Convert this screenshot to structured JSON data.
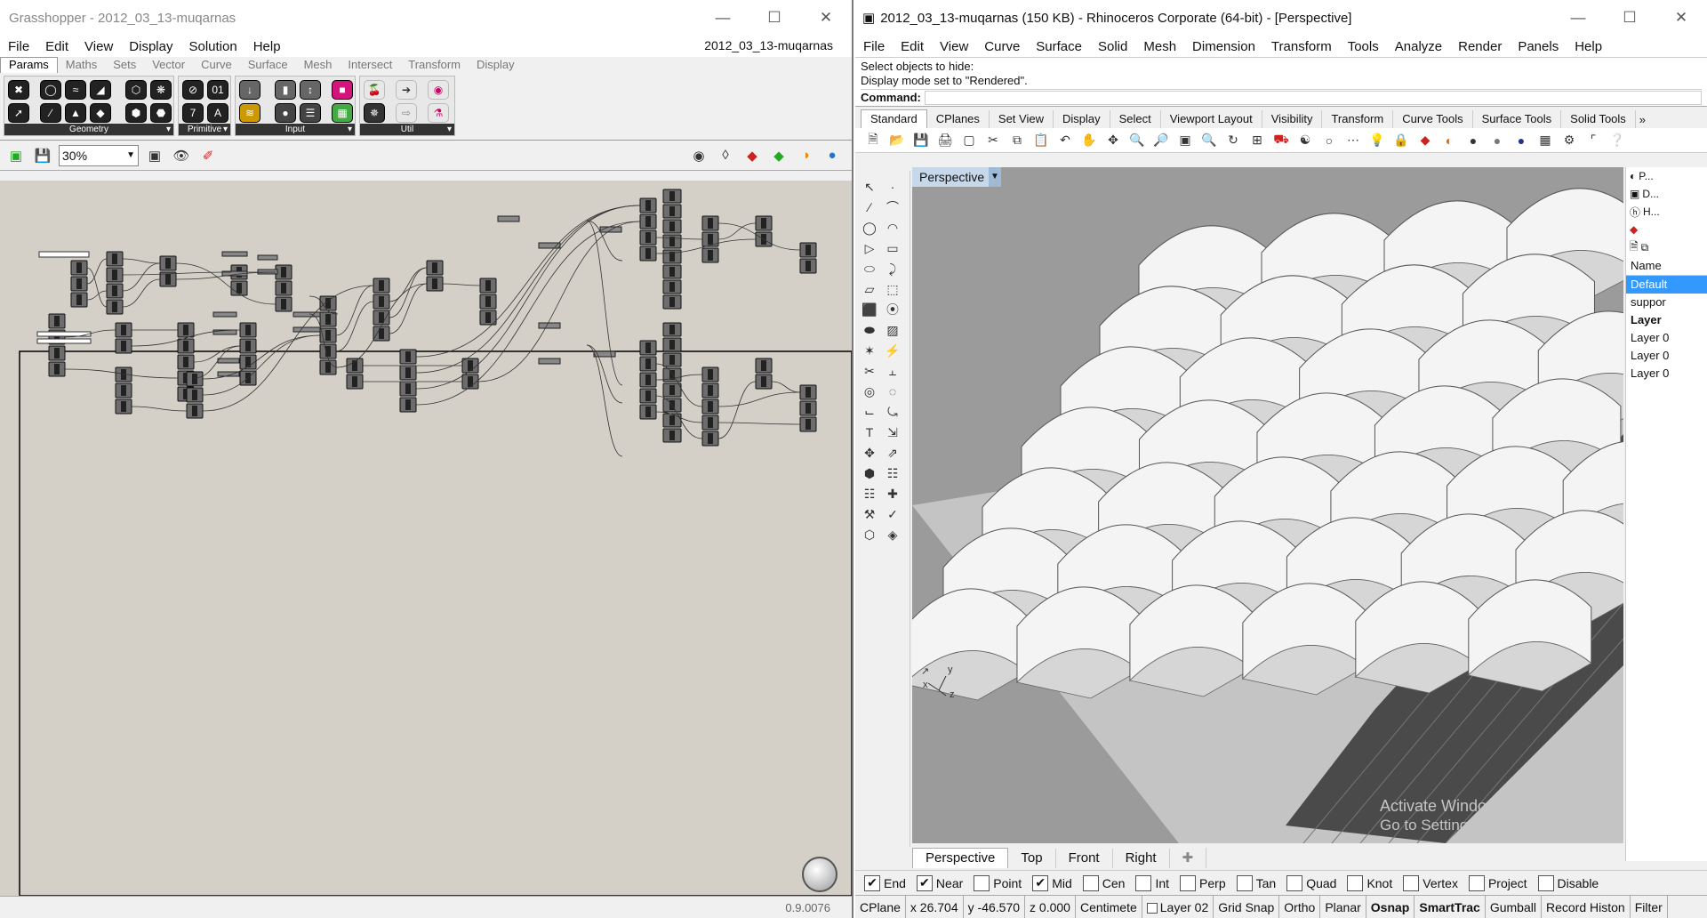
{
  "grasshopper": {
    "title": "Grasshopper - 2012_03_13-muqarnas",
    "document_name": "2012_03_13-muqarnas",
    "menu": [
      "File",
      "Edit",
      "View",
      "Display",
      "Solution",
      "Help"
    ],
    "tabs": [
      {
        "label": "Params",
        "active": true
      },
      {
        "label": "Maths",
        "active": false
      },
      {
        "label": "Sets",
        "active": false
      },
      {
        "label": "Vector",
        "active": false
      },
      {
        "label": "Curve",
        "active": false
      },
      {
        "label": "Surface",
        "active": false
      },
      {
        "label": "Mesh",
        "active": false
      },
      {
        "label": "Intersect",
        "active": false
      },
      {
        "label": "Transform",
        "active": false
      },
      {
        "label": "Display",
        "active": false
      }
    ],
    "panels": [
      "Geometry",
      "Primitive",
      "Input",
      "Util"
    ],
    "zoom": "30%",
    "version": "0.9.0076"
  },
  "rhino": {
    "title": "2012_03_13-muqarnas (150 KB) - Rhinoceros Corporate (64-bit) - [Perspective]",
    "menu": [
      "File",
      "Edit",
      "View",
      "Curve",
      "Surface",
      "Solid",
      "Mesh",
      "Dimension",
      "Transform",
      "Tools",
      "Analyze",
      "Render",
      "Panels",
      "Help"
    ],
    "command_history": [
      "Select objects to hide:",
      "Display mode set to \"Rendered\"."
    ],
    "command_label": "Command:",
    "toolbar_tabs": [
      {
        "label": "Standard",
        "active": true
      },
      {
        "label": "CPlanes",
        "active": false
      },
      {
        "label": "Set View",
        "active": false
      },
      {
        "label": "Display",
        "active": false
      },
      {
        "label": "Select",
        "active": false
      },
      {
        "label": "Viewport Layout",
        "active": false
      },
      {
        "label": "Visibility",
        "active": false
      },
      {
        "label": "Transform",
        "active": false
      },
      {
        "label": "Curve Tools",
        "active": false
      },
      {
        "label": "Surface Tools",
        "active": false
      },
      {
        "label": "Solid Tools",
        "active": false
      }
    ],
    "viewport_title": "Perspective",
    "viewport_tabs": [
      {
        "label": "Perspective",
        "active": true
      },
      {
        "label": "Top",
        "active": false
      },
      {
        "label": "Front",
        "active": false
      },
      {
        "label": "Right",
        "active": false
      }
    ],
    "panel_tabs": [
      "P...",
      "D...",
      "H..."
    ],
    "layers_header": "Name",
    "layers": [
      {
        "name": "Default",
        "selected": true,
        "bold": false
      },
      {
        "name": "suppor",
        "selected": false,
        "bold": false
      },
      {
        "name": "Layer",
        "selected": false,
        "bold": true
      },
      {
        "name": "Layer 0",
        "selected": false,
        "bold": false
      },
      {
        "name": "Layer 0",
        "selected": false,
        "bold": false
      },
      {
        "name": "Layer 0",
        "selected": false,
        "bold": false
      }
    ],
    "osnaps": [
      {
        "label": "End",
        "checked": true
      },
      {
        "label": "Near",
        "checked": true
      },
      {
        "label": "Point",
        "checked": false
      },
      {
        "label": "Mid",
        "checked": true
      },
      {
        "label": "Cen",
        "checked": false
      },
      {
        "label": "Int",
        "checked": false
      },
      {
        "label": "Perp",
        "checked": false
      },
      {
        "label": "Tan",
        "checked": false
      },
      {
        "label": "Quad",
        "checked": false
      },
      {
        "label": "Knot",
        "checked": false
      },
      {
        "label": "Vertex",
        "checked": false
      },
      {
        "label": "Project",
        "checked": false
      },
      {
        "label": "Disable",
        "checked": false
      }
    ],
    "status": {
      "cplane": "CPlane",
      "x": "x 26.704",
      "y": "y -46.570",
      "z": "z 0.000",
      "units": "Centimete",
      "layer": "Layer 02",
      "toggles": [
        "Grid Snap",
        "Ortho",
        "Planar",
        "Osnap",
        "SmartTrac",
        "Gumball",
        "Record Histon",
        "Filter"
      ]
    },
    "watermark_line1": "Activate Windows",
    "watermark_line2": "Go to Settings to activate Windows."
  }
}
